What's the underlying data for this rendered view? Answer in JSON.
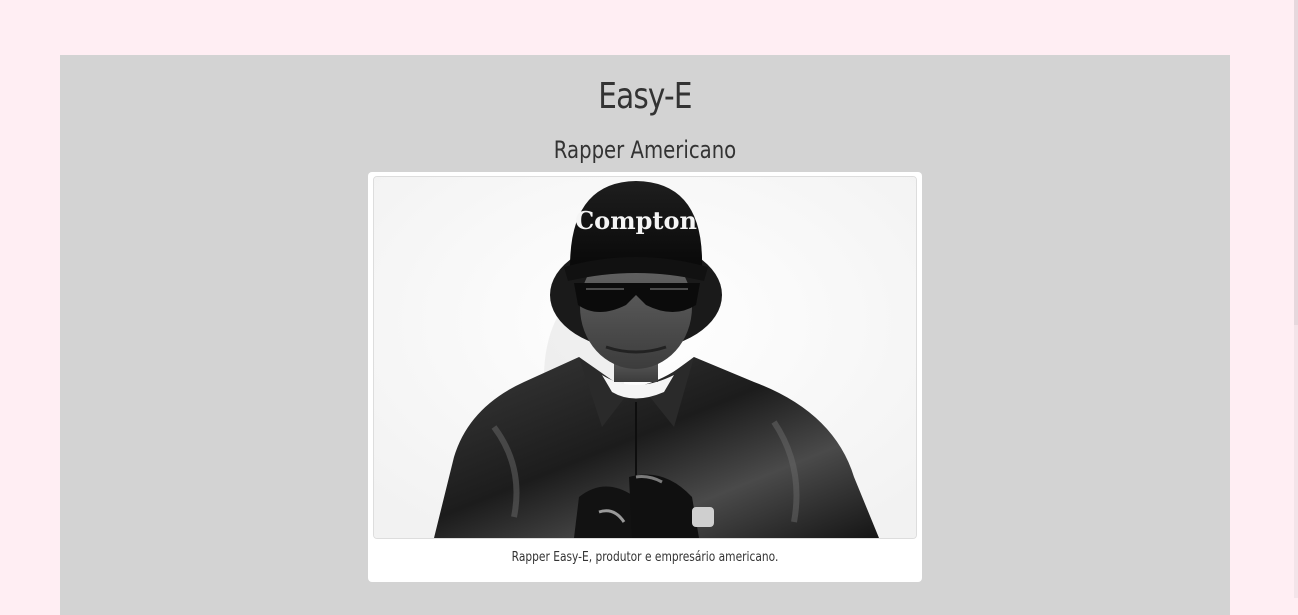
{
  "page": {
    "title": "Easy-E",
    "subtitle": "Rapper Americano"
  },
  "figure": {
    "image_alt": "Rapper Easy-E",
    "cap_text": "Compton",
    "caption": "Rapper Easy-E, produtor e empresário americano."
  },
  "colors": {
    "page_background": "#ffeef3",
    "panel_background": "#d3d3d3",
    "card_background": "#ffffff",
    "text": "#333333"
  }
}
